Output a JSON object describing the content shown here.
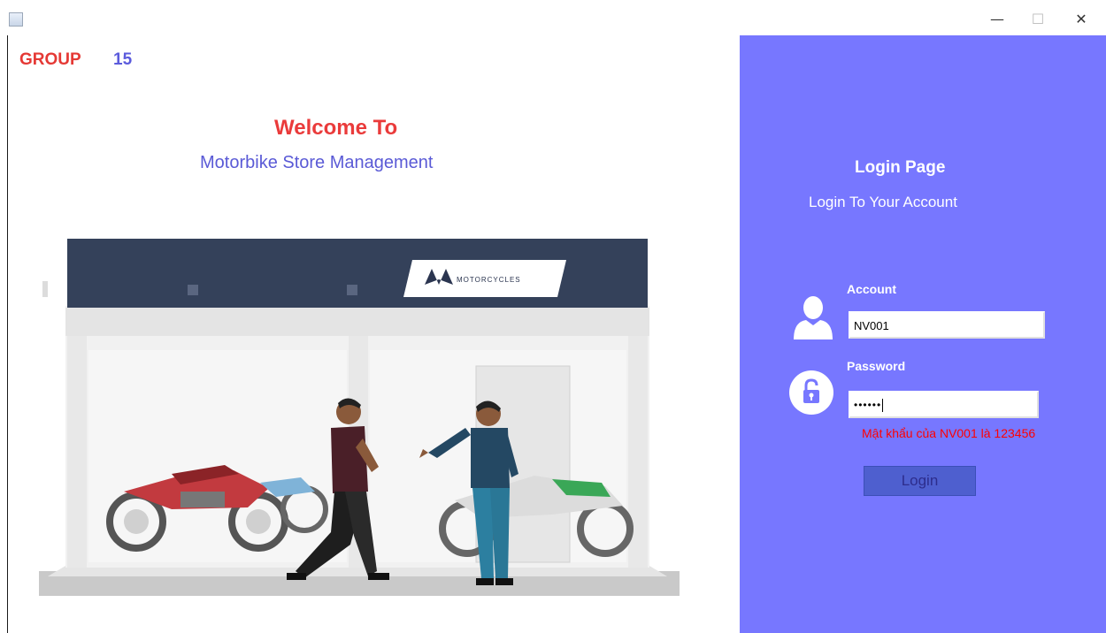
{
  "window": {
    "minimize_glyph": "—",
    "maximize_glyph": "☐",
    "close_glyph": "✕"
  },
  "header": {
    "group_label": "GROUP",
    "group_number": "15"
  },
  "welcome": {
    "title": "Welcome To",
    "subtitle": "Motorbike Store Management"
  },
  "illustration": {
    "store_sign": "MOTORCYCLES"
  },
  "login": {
    "title": "Login Page",
    "subtitle": "Login To Your Account",
    "account_label": "Account",
    "account_value": "NV001",
    "password_label": "Password",
    "password_value": "••••••",
    "hint": "Mật khẩu của NV001 là 123456",
    "button_label": "Login"
  },
  "colors": {
    "panel": "#7777ff",
    "accent_red": "#e53935",
    "accent_blue": "#5b5bdc",
    "button": "#4e5fcf"
  }
}
